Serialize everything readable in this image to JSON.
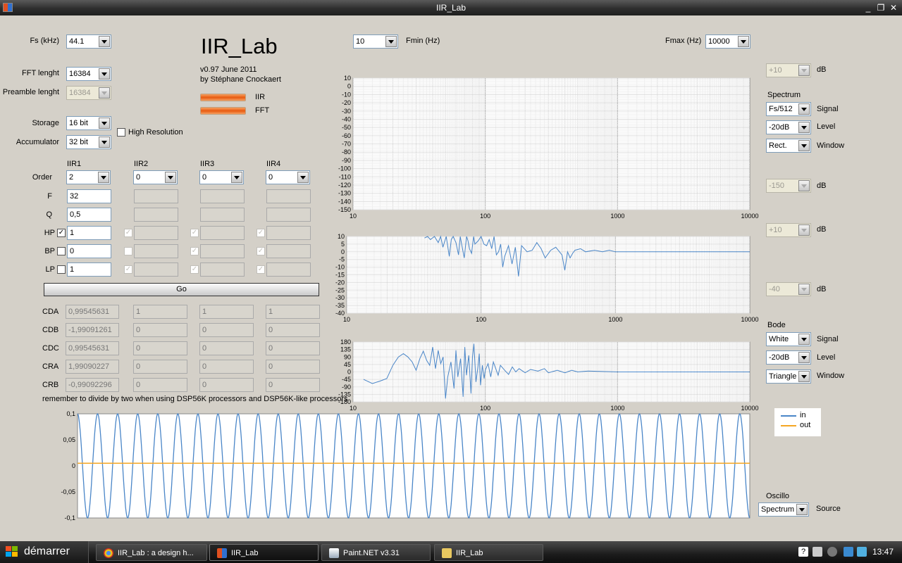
{
  "window": {
    "title": "IIR_Lab"
  },
  "app": {
    "title": "IIR_Lab",
    "version": "v0.97 June 2011",
    "author": "by Stéphane Cnockaert",
    "progress": [
      {
        "label": "IIR",
        "value": 1.0
      },
      {
        "label": "FFT",
        "value": 1.0
      }
    ]
  },
  "settings": {
    "fs": {
      "label": "Fs (kHz)",
      "value": "44.1"
    },
    "fft_length": {
      "label": "FFT lenght",
      "value": "16384"
    },
    "preamble_length": {
      "label": "Preamble lenght",
      "value": "16384"
    },
    "storage": {
      "label": "Storage",
      "value": "16 bit"
    },
    "accumulator": {
      "label": "Accumulator",
      "value": "32 bit"
    },
    "high_resolution": {
      "label": "High Resolution",
      "checked": false
    }
  },
  "filters": {
    "row_labels": {
      "order": "Order",
      "f": "F",
      "q": "Q",
      "hp": "HP",
      "bp": "BP",
      "lp": "LP"
    },
    "columns": [
      {
        "name": "IIR1",
        "order": "2",
        "f": "32",
        "q": "0,5",
        "hp": "1",
        "bp": "0",
        "lp": "1"
      },
      {
        "name": "IIR2",
        "order": "0",
        "f": "",
        "q": "",
        "hp": "",
        "bp": "",
        "lp": ""
      },
      {
        "name": "IIR3",
        "order": "0",
        "f": "",
        "q": "",
        "hp": "",
        "bp": "",
        "lp": ""
      },
      {
        "name": "IIR4",
        "order": "0",
        "f": "",
        "q": "",
        "hp": "",
        "bp": "",
        "lp": ""
      }
    ],
    "go_label": "Go"
  },
  "coefficients": {
    "rows": [
      {
        "label": "CDA",
        "values": [
          "0,99545631",
          "1",
          "1",
          "1"
        ]
      },
      {
        "label": "CDB",
        "values": [
          "-1,99091261",
          "0",
          "0",
          "0"
        ]
      },
      {
        "label": "CDC",
        "values": [
          "0,99545631",
          "0",
          "0",
          "0"
        ]
      },
      {
        "label": "CRA",
        "values": [
          "1,99090227",
          "0",
          "0",
          "0"
        ]
      },
      {
        "label": "CRB",
        "values": [
          "-0,99092296",
          "0",
          "0",
          "0"
        ]
      }
    ],
    "note": "remember to divide by two when using DSP56K processors and DSP56K-like processors"
  },
  "freq": {
    "fmin_label": "Fmin (Hz)",
    "fmin": "10",
    "fmax_label": "Fmax (Hz)",
    "fmax": "10000"
  },
  "right_panel": {
    "db_label": "dB",
    "spectrum_top": "+10",
    "spectrum_bottom": "-150",
    "spectrum": {
      "title": "Spectrum",
      "signal_label": "Signal",
      "signal": "Fs/512",
      "level_label": "Level",
      "level": "-20dB",
      "window_label": "Window",
      "window": "Rect."
    },
    "mag_top": "+10",
    "mag_bottom": "-40",
    "bode": {
      "title": "Bode",
      "signal_label": "Signal",
      "signal": "White",
      "level_label": "Level",
      "level": "-20dB",
      "window_label": "Window",
      "window": "Triangle"
    },
    "oscillo": {
      "title": "Oscillo",
      "source_label": "Source",
      "source": "Spectrum"
    }
  },
  "colors": {
    "blue": "#4a86c8",
    "orange": "#f5a623",
    "grid_minor": "#dddddd",
    "grid_major": "#9a9a9a"
  },
  "chart_data": [
    {
      "type": "line",
      "name": "spectrum",
      "xscale": "log",
      "xlim": [
        10,
        10000
      ],
      "ylim": [
        -150,
        10
      ],
      "xticks": [
        "10",
        "100",
        "1000",
        "10000"
      ],
      "yticks": [
        "10",
        "0",
        "-10",
        "-20",
        "-30",
        "-40",
        "-50",
        "-60",
        "-70",
        "-80",
        "-90",
        "-100",
        "-110",
        "-120",
        "-130",
        "-140",
        "-150"
      ],
      "series": []
    },
    {
      "type": "line",
      "name": "magnitude",
      "xscale": "log",
      "xlim": [
        10,
        10000
      ],
      "ylim": [
        -40,
        10
      ],
      "xticks": [
        "10",
        "100",
        "1000",
        "10000"
      ],
      "yticks": [
        "10",
        "5",
        "0",
        "-5",
        "-10",
        "-15",
        "-20",
        "-25",
        "-30",
        "-35",
        "-40"
      ],
      "series": [
        {
          "x": [
            38,
            40,
            42,
            45,
            48,
            50,
            52,
            55,
            58,
            60,
            62,
            65,
            68,
            70,
            72,
            75,
            78,
            80,
            82,
            85,
            88,
            90,
            95,
            100,
            105,
            110,
            115,
            120,
            125,
            130,
            135,
            140,
            145,
            150,
            160,
            170,
            180,
            190,
            200,
            220,
            240,
            260,
            280,
            300,
            330,
            360,
            400,
            420,
            440,
            460,
            480,
            500,
            550,
            600,
            700,
            800,
            900,
            1000,
            2000,
            5000,
            10000
          ],
          "y": [
            9,
            10,
            8,
            10,
            6,
            10,
            3,
            10,
            -3,
            8,
            10,
            6,
            -2,
            10,
            4,
            -4,
            10,
            7,
            2,
            -1,
            10,
            5,
            7,
            10,
            5,
            4,
            8,
            2,
            10,
            -2,
            0,
            5,
            -10,
            -3,
            4,
            -8,
            3,
            -16,
            4,
            0,
            1,
            6,
            2,
            -4,
            1,
            3,
            -2,
            -12,
            0,
            -4,
            -1,
            1,
            2,
            0,
            1,
            0,
            1,
            0,
            0,
            0,
            0
          ]
        }
      ]
    },
    {
      "type": "line",
      "name": "phase",
      "xscale": "log",
      "xlim": [
        10,
        10000
      ],
      "ylim": [
        -180,
        180
      ],
      "xticks": [
        "10",
        "100",
        "1000",
        "10000"
      ],
      "yticks": [
        "180",
        "135",
        "90",
        "45",
        "0",
        "-45",
        "-90",
        "-135",
        "-180"
      ],
      "series": [
        {
          "x": [
            12,
            14,
            16,
            18,
            20,
            22,
            24,
            26,
            28,
            30,
            32,
            34,
            36,
            38,
            40,
            42,
            44,
            46,
            48,
            50,
            52,
            55,
            58,
            60,
            62,
            65,
            68,
            70,
            72,
            75,
            78,
            80,
            82,
            85,
            88,
            90,
            92,
            95,
            98,
            100,
            105,
            110,
            115,
            120,
            125,
            130,
            140,
            150,
            160,
            170,
            180,
            200,
            220,
            250,
            280,
            300,
            350,
            400,
            450,
            500,
            600,
            800,
            1000,
            2000,
            5000,
            10000
          ],
          "y": [
            -45,
            -70,
            -55,
            -40,
            40,
            90,
            110,
            90,
            60,
            10,
            80,
            125,
            70,
            40,
            150,
            20,
            130,
            50,
            90,
            -160,
            -30,
            60,
            -100,
            130,
            -30,
            80,
            -150,
            150,
            -20,
            100,
            -130,
            90,
            170,
            -60,
            30,
            110,
            -80,
            40,
            -40,
            10,
            50,
            -30,
            60,
            20,
            -20,
            40,
            10,
            -15,
            30,
            0,
            20,
            -5,
            15,
            5,
            20,
            -5,
            10,
            -5,
            10,
            0,
            5,
            2,
            0,
            0,
            0,
            0
          ]
        }
      ]
    },
    {
      "type": "line",
      "name": "oscillo",
      "ylim": [
        -0.1,
        0.1
      ],
      "yticks": [
        "0,1",
        "0,05",
        "0",
        "-0,05",
        "-0,1"
      ],
      "series": [
        {
          "name": "in",
          "amplitude": 0.1,
          "cycles": 33.5,
          "color": "#4a86c8"
        },
        {
          "name": "out",
          "value": 0.005,
          "color": "#f5a623"
        }
      ]
    }
  ],
  "taskbar": {
    "start": "démarrer",
    "tasks": [
      {
        "label": "IIR_Lab : a design h...",
        "icon": "chrome-icon"
      },
      {
        "label": "IIR_Lab",
        "icon": "app-icon"
      },
      {
        "label": "Paint.NET v3.31",
        "icon": "paintnet-icon"
      },
      {
        "label": "IIR_Lab",
        "icon": "folder-icon"
      }
    ],
    "clock": "13:47"
  }
}
